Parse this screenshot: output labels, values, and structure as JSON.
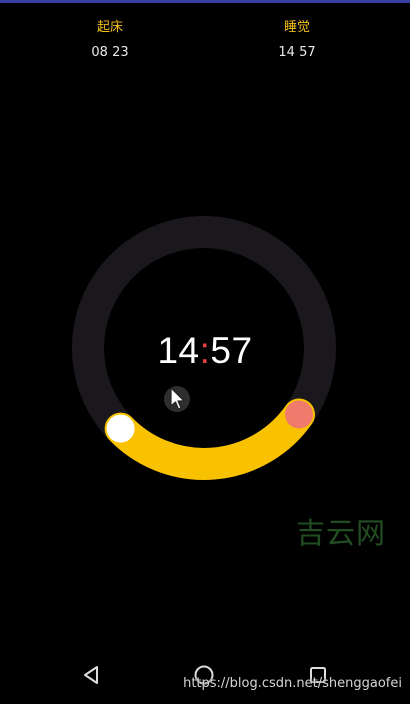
{
  "schedule": {
    "wake": {
      "label": "起床",
      "time": "08 23"
    },
    "sleep": {
      "label": "睡觉",
      "time": "14 57"
    }
  },
  "clock": {
    "hours": "14",
    "separator": ":",
    "minutes": "57"
  },
  "colors": {
    "background": "#000000",
    "track": "#1b181d",
    "arc": "#f8c200",
    "wake_knob": "#ffffff",
    "sleep_knob": "#f07a6c",
    "label_accent": "#f3c01c",
    "colon_accent": "#e74040"
  },
  "watermark": {
    "brand": "吉云网",
    "url": "https://blog.csdn.net/shenggaofei"
  },
  "navigation": {
    "icons": [
      "back-icon",
      "home-icon",
      "recents-icon"
    ]
  }
}
